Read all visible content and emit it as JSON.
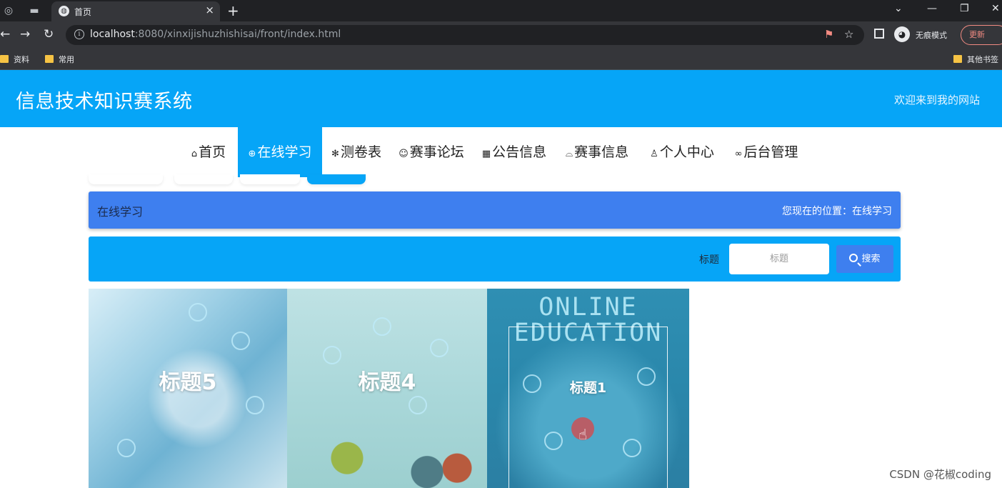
{
  "browser": {
    "tab_title": "首页",
    "tab_close": "×",
    "new_tab": "+",
    "url_host": "localhost",
    "url_rest": ":8080/xinxijishuzhishisai/front/index.html",
    "incognito_label": "无痕模式",
    "update_label": "更新",
    "bookmarks": [
      "资料",
      "常用"
    ],
    "other_bookmarks": "其他书签"
  },
  "header": {
    "site_title": "信息技术知识赛系统",
    "welcome": "欢迎来到我的网站"
  },
  "nav": {
    "items": [
      {
        "icon": "⌂",
        "label": "首页"
      },
      {
        "icon": "⊕",
        "label": "在线学习"
      },
      {
        "icon": "✻",
        "label": "测卷表"
      },
      {
        "icon": "☺",
        "label": "赛事论坛"
      },
      {
        "icon": "▦",
        "label": "公告信息"
      },
      {
        "icon": "⌓",
        "label": "赛事信息"
      },
      {
        "icon": "♙",
        "label": "个人中心"
      },
      {
        "icon": "∞",
        "label": "后台管理"
      }
    ],
    "active_index": 1
  },
  "breadcrumb": {
    "title": "在线学习",
    "position": "您现在的位置：在线学习"
  },
  "search": {
    "label": "标题",
    "placeholder": "标题",
    "button": "搜索"
  },
  "cards": [
    {
      "title": "标题5"
    },
    {
      "title": "标题4"
    },
    {
      "title": "标题1",
      "image_text": "ONLINE EDUCATION"
    }
  ],
  "watermark": "CSDN @花椒coding",
  "colors": {
    "header_bg": "#06a5f7",
    "breadcrumb_bg": "#3e7fef",
    "search_button_bg": "#3e7fef"
  }
}
